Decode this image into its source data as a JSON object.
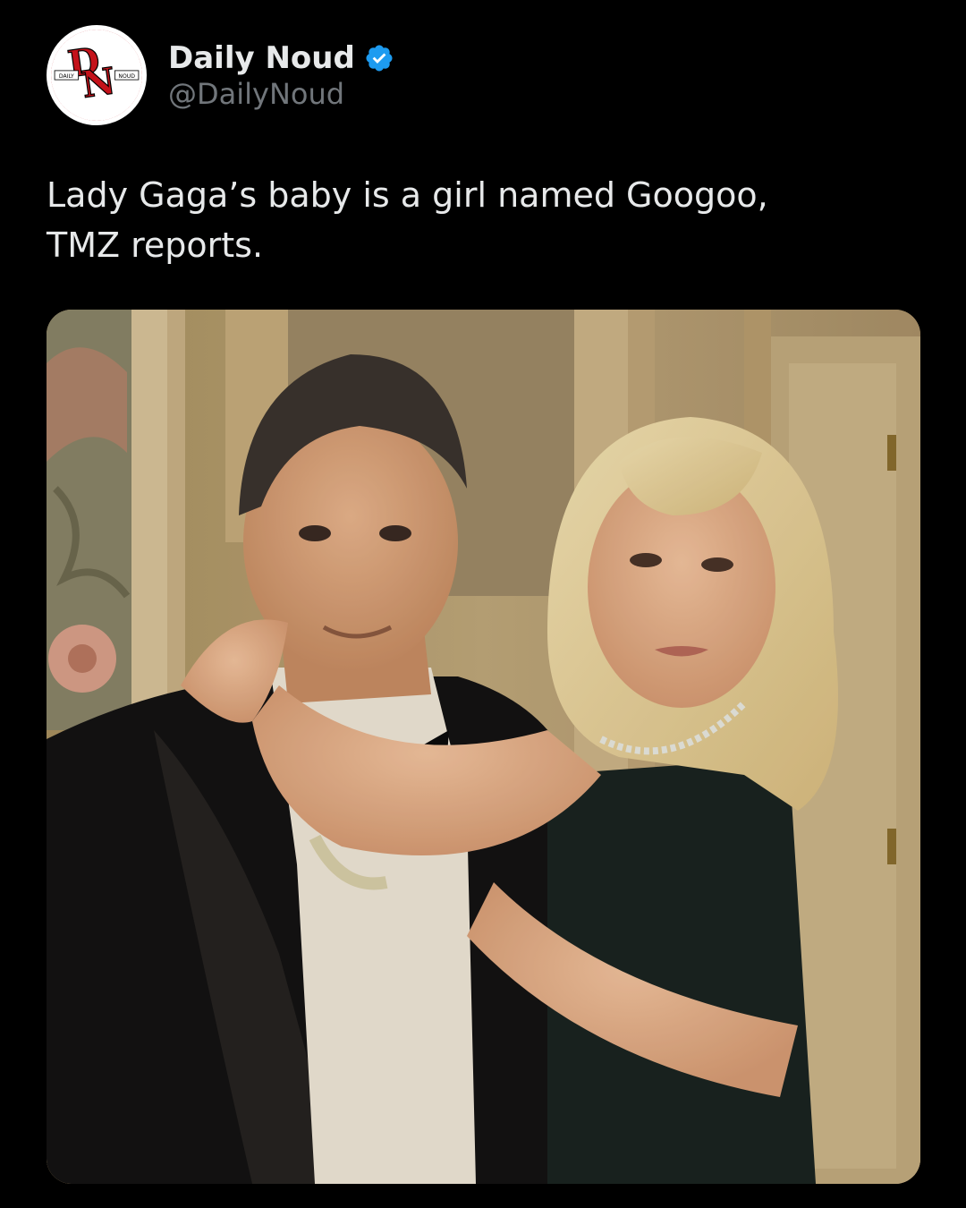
{
  "account": {
    "display_name": "Daily Noud",
    "handle": "@DailyNoud",
    "verified": true,
    "avatar": {
      "logo_letters": "DN",
      "left_text": "DAILY",
      "right_text": "NOUD",
      "brand_color": "#c4121a"
    }
  },
  "tweet": {
    "text_lines": [
      "Lady Gaga’s baby is a girl named Googoo,",
      "TMZ reports."
    ]
  },
  "media": {
    "type": "photo",
    "icon": "photo-of-couple-in-formal-wear"
  },
  "colors": {
    "background": "#000000",
    "text_primary": "#e7e9ea",
    "text_secondary": "#71767b",
    "verified_blue": "#1d9bf0"
  }
}
